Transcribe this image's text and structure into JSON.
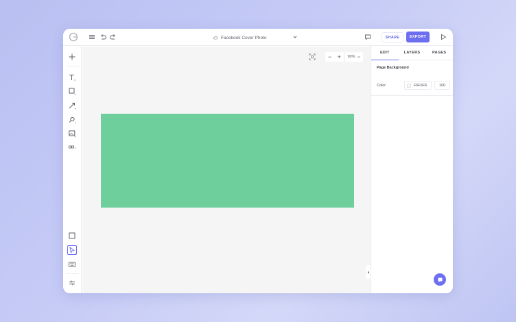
{
  "app": {
    "logo": "logo-icon"
  },
  "toolbar": {
    "document_title": "Facebook Cover Photo",
    "share_label": "SHARE",
    "export_label": "EXPORT",
    "accent_color": "#6d6ff0"
  },
  "sidebar": {
    "tools": [
      "add-icon",
      "text-tool-icon",
      "shape-tool-icon",
      "line-tool-icon",
      "brush-tool-icon",
      "image-tool-icon",
      "more-tools-icon"
    ],
    "bottom_tools": [
      "page-size-icon",
      "select-tool-icon",
      "keyboard-icon",
      "settings-icon"
    ]
  },
  "canvas": {
    "background_color": "#f5f5f6",
    "shape_color": "#6ecf9d",
    "zoom_level": "90%",
    "zoom_out": "−",
    "zoom_in": "+"
  },
  "panel": {
    "tabs": [
      {
        "label": "EDIT",
        "active": true
      },
      {
        "label": "LAYERS",
        "active": false
      },
      {
        "label": "PAGES",
        "active": false
      }
    ],
    "section_title": "Page Background",
    "color_label": "Color",
    "color_value": "F6F6F6",
    "opacity_value": "100"
  }
}
